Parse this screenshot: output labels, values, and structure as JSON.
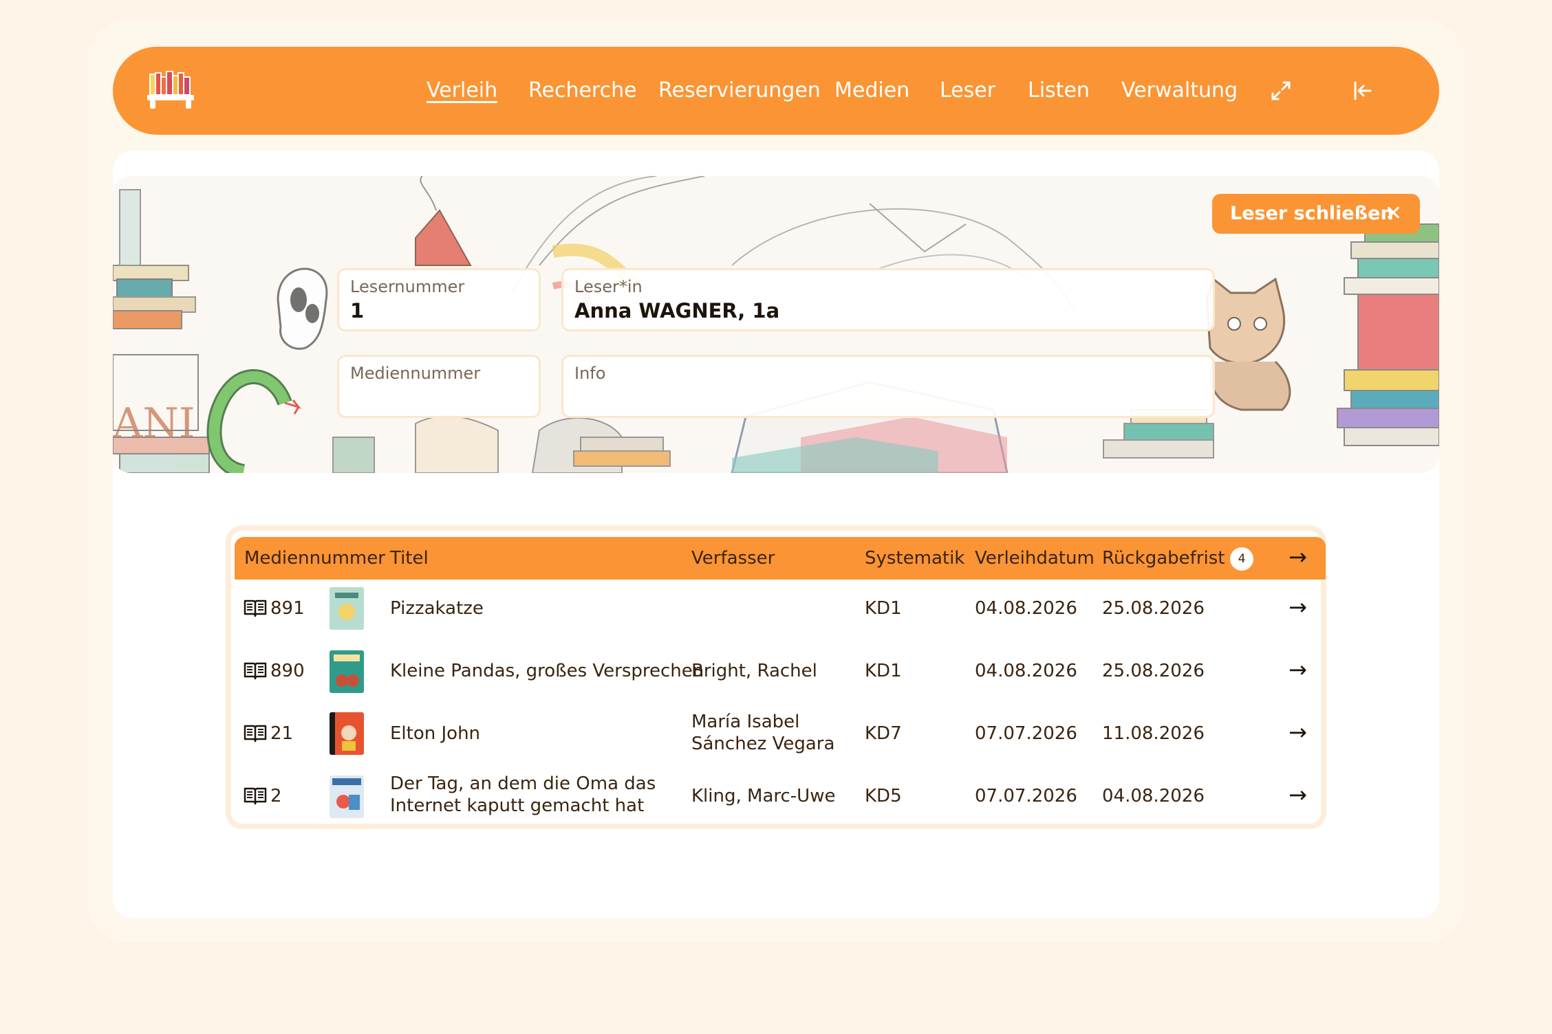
{
  "header": {
    "logo_icon": "bookshelf-icon",
    "nav": [
      {
        "label": "Verleih",
        "active": true
      },
      {
        "label": "Recherche",
        "active": false
      },
      {
        "label": "Reservierungen",
        "active": false
      },
      {
        "label": "Medien",
        "active": false
      },
      {
        "label": "Leser",
        "active": false
      },
      {
        "label": "Listen",
        "active": false
      },
      {
        "label": "Verwaltung",
        "active": false
      }
    ],
    "fullscreen_icon": "expand-icon",
    "logout_icon": "logout-icon"
  },
  "reader": {
    "close_label": "Leser schließen",
    "close_icon": "close-icon",
    "reader_number": {
      "label": "Lesernummer",
      "value": "1"
    },
    "reader_name": {
      "label": "Leser*in",
      "value": "Anna WAGNER, 1a"
    },
    "media_number": {
      "label": "Mediennummer",
      "value": ""
    },
    "info": {
      "label": "Info",
      "value": ""
    }
  },
  "loans_table": {
    "columns": {
      "media_number": "Mediennummer",
      "title": "Titel",
      "author": "Verfasser",
      "classification": "Systematik",
      "loan_date": "Verleihdatum",
      "due_date": "Rückgabefrist",
      "count": "4",
      "return_all_icon": "arrow-right-icon"
    },
    "rows": [
      {
        "type_icon": "book-icon",
        "number": "891",
        "title": "Pizzakatze",
        "author": "",
        "classification": "KD1",
        "loan_date": "04.08.2026",
        "due_date": "25.08.2026"
      },
      {
        "type_icon": "book-icon",
        "number": "890",
        "title": "Kleine Pandas, großes Versprechen",
        "author": "Bright, Rachel",
        "classification": "KD1",
        "loan_date": "04.08.2026",
        "due_date": "25.08.2026"
      },
      {
        "type_icon": "book-icon",
        "number": "21",
        "title": "Elton John",
        "author": "María Isabel Sánchez Vegara",
        "classification": "KD7",
        "loan_date": "07.07.2026",
        "due_date": "11.08.2026"
      },
      {
        "type_icon": "book-icon",
        "number": "2",
        "title": "Der Tag, an dem die Oma das Internet kaputt gemacht hat",
        "author": "Kling, Marc-Uwe",
        "classification": "KD5",
        "loan_date": "07.07.2026",
        "due_date": "04.08.2026"
      }
    ]
  },
  "colors": {
    "accent": "#fb9434",
    "page_bg": "#fdf4e7",
    "text_dark": "#3b2410"
  }
}
